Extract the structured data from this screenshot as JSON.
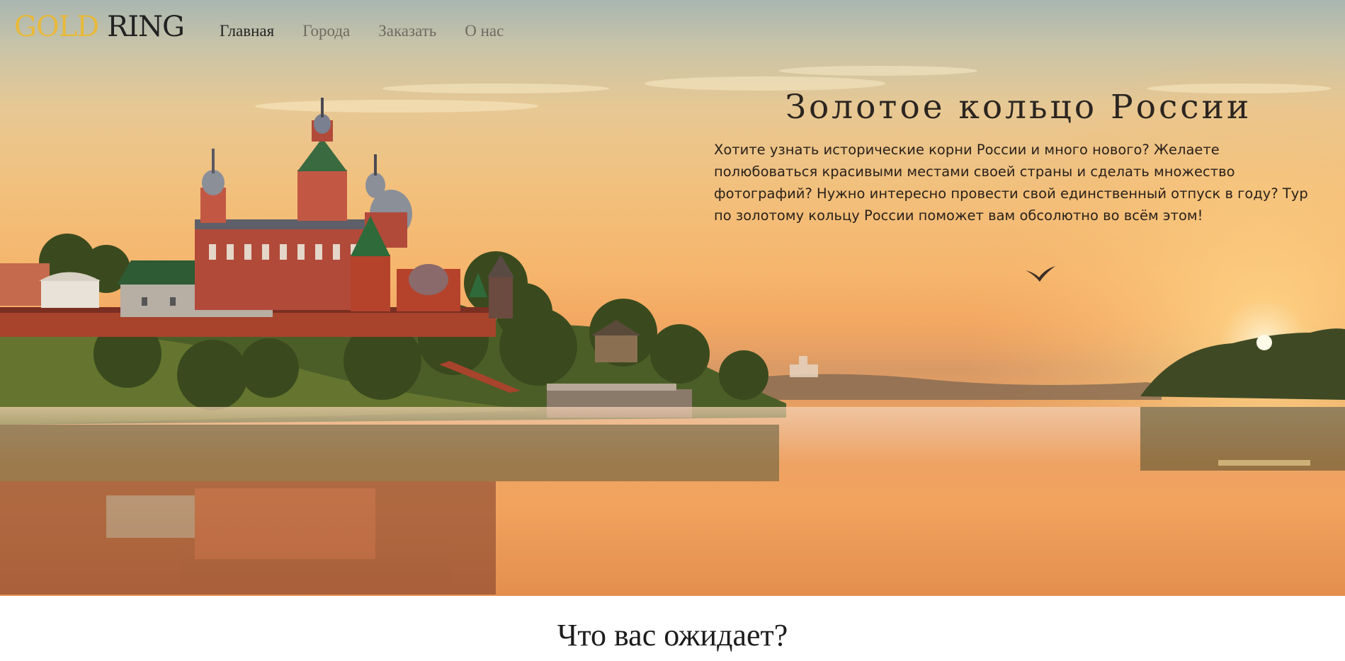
{
  "logo": {
    "part1": "GOLD",
    "part2": "RING"
  },
  "nav": {
    "items": [
      {
        "label": "Главная",
        "active": true
      },
      {
        "label": "Города",
        "active": false
      },
      {
        "label": "Заказать",
        "active": false
      },
      {
        "label": "О нас",
        "active": false
      }
    ]
  },
  "hero": {
    "title": "Золотое кольцо России",
    "text": "Хотите узнать исторические корни России и много нового? Желаете полюбоваться красивыми местами своей страны и сделать множество фотографий? Нужно интересно провести свой единственный отпуск в году? Тур по золотому кольцу России поможет вам обсолютно во всём этом!"
  },
  "section": {
    "title": "Что вас ожидает?"
  },
  "colors": {
    "gold": "#e8b93a",
    "text_dark": "#232323",
    "nav_muted": "#6f6a60"
  }
}
